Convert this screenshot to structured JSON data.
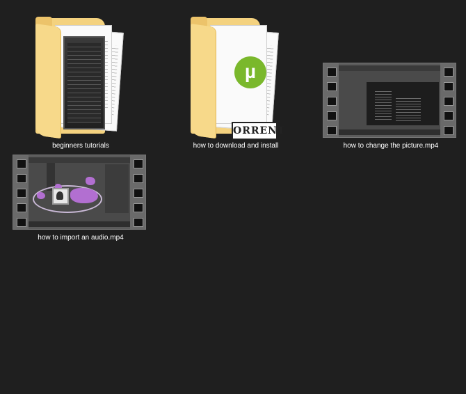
{
  "items": [
    {
      "label": "beginners tutorials",
      "icon": "folder-icon"
    },
    {
      "label": "how to download and install",
      "icon": "folder-icon"
    },
    {
      "label": "how to change the picture.mp4",
      "icon": "video-thumbnail-icon"
    },
    {
      "label": "how to import an audio.mp4",
      "icon": "video-thumbnail-icon"
    }
  ],
  "utorrent": {
    "logo_glyph": "µ",
    "doc_text": "ORRENT"
  },
  "colors": {
    "background": "#1f1f1f",
    "folder": "#f4d27f",
    "utorrent_green": "#7ab82c"
  }
}
